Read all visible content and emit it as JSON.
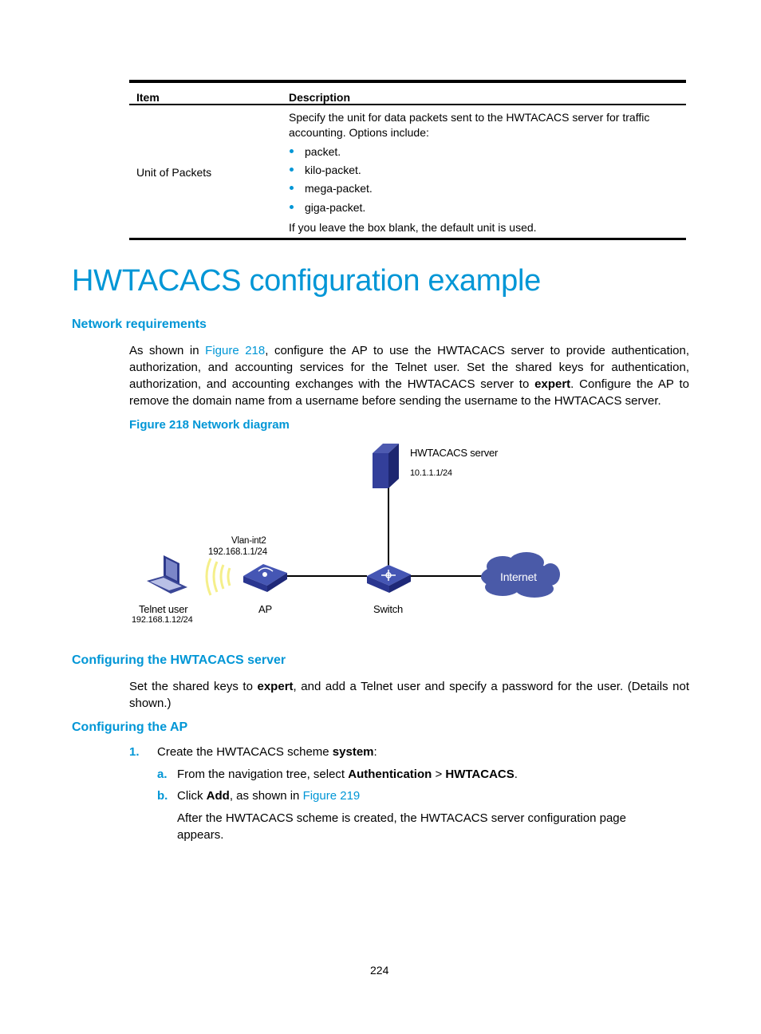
{
  "table": {
    "headers": {
      "item": "Item",
      "description": "Description"
    },
    "rows": [
      {
        "item": "Unit of Packets",
        "description_lines": [
          "Specify the unit for data packets sent to the HWTACACS server for traffic",
          "accounting. Options include:"
        ],
        "options": [
          "packet.",
          "kilo-packet.",
          "mega-packet.",
          "giga-packet."
        ],
        "note": "If you leave the box blank, the default unit is used."
      }
    ]
  },
  "section_title": "HWTACACS configuration example",
  "network_requirements": {
    "heading": "Network requirements",
    "para_lines": [
      {
        "pre": "As shown in ",
        "link": "Figure 218",
        "post": ", configure the AP to use the HWTACACS server to provide authentication,"
      },
      {
        "text": "authorization, and accounting services for the Telnet user. Set the shared keys for authentication,"
      },
      {
        "pre": "authorization, and accounting exchanges with the HWTACACS server to ",
        "bold": "expert",
        "post": ". Configure the AP to"
      },
      {
        "text": "remove the domain name from a username before sending the username to the HWTACACS server."
      }
    ],
    "figure_caption": "Figure 218 Network diagram"
  },
  "diagram": {
    "server": {
      "name": "HWTACACS server",
      "ip": "10.1.1.1/24"
    },
    "ap": {
      "name": "AP",
      "interface": "Vlan-int2",
      "ip": "192.168.1.1/24"
    },
    "telnet_user": {
      "name": "Telnet user",
      "ip": "192.168.1.12/24"
    },
    "switch": {
      "name": "Switch"
    },
    "internet": {
      "name": "Internet"
    },
    "colors": {
      "device": "#2e3a8c",
      "cloud": "#4a5aa8",
      "wireless": "#f5ef8a"
    }
  },
  "configuring_server": {
    "heading": "Configuring the HWTACACS server",
    "line1_pre": "Set the shared keys to ",
    "line1_bold": "expert",
    "line1_post": ", and add a Telnet user and specify a password for the user. (Details not",
    "line2": "shown.)"
  },
  "configuring_ap": {
    "heading": "Configuring the AP",
    "steps": [
      {
        "num": "1.",
        "pre": "Create the HWTACACS scheme ",
        "bold": "system",
        "post": ":",
        "substeps": [
          {
            "num": "a.",
            "pre": "From the navigation tree, select ",
            "bold1": "Authentication",
            "mid": " > ",
            "bold2": "HWTACACS",
            "post": "."
          },
          {
            "num": "b.",
            "pre": "Click ",
            "bold": "Add",
            "mid": ", as shown in ",
            "link": "Figure 219"
          }
        ],
        "after_lines": [
          "After the HWTACACS scheme is created, the HWTACACS server configuration page",
          "appears."
        ]
      }
    ]
  },
  "page_number": "224"
}
